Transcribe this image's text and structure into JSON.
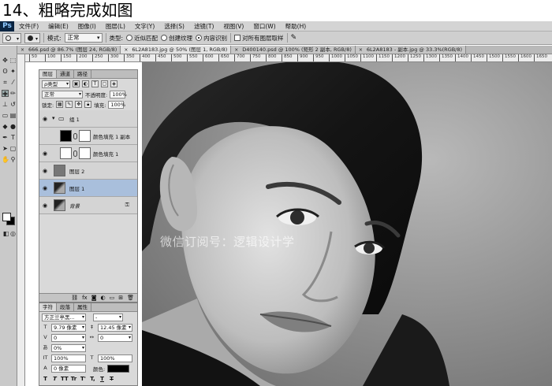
{
  "heading": "14、粗略完成如图",
  "app": {
    "logo": "Ps"
  },
  "menu": [
    "文件(F)",
    "编辑(E)",
    "图像(I)",
    "图层(L)",
    "文字(Y)",
    "选择(S)",
    "滤镜(T)",
    "视图(V)",
    "窗口(W)",
    "帮助(H)"
  ],
  "options": {
    "mode_label": "模式:",
    "mode_value": "正常",
    "type_label": "类型:",
    "type_options": [
      "近似匹配",
      "创建纹理",
      "内容识别"
    ],
    "type_selected_index": 2,
    "sample_all_label": "对所有图层取样"
  },
  "doc_tabs": [
    {
      "title": "666.psd @ 86.7% (图层 24, RGB/8)",
      "active": false
    },
    {
      "title": "6L2A8183.jpg @ 50% (图层 1, RGB/8)",
      "active": true
    },
    {
      "title": "D400140.psd @ 100% (矩形 2 副本, RGB/8)",
      "active": false
    },
    {
      "title": "6L2A8183 - 副本.jpg @ 33.3%(RGB/8)",
      "active": false
    }
  ],
  "ruler_ticks": [
    "50",
    "100",
    "150",
    "200",
    "250",
    "300",
    "350",
    "400",
    "450",
    "500",
    "550",
    "600",
    "650",
    "700",
    "750",
    "800",
    "850",
    "900",
    "950",
    "1000",
    "1050",
    "1100",
    "1150",
    "1200",
    "1250",
    "1300",
    "1350",
    "1400",
    "1450",
    "1500",
    "1550",
    "1600",
    "1650"
  ],
  "layers_panel": {
    "tabs": [
      "图层",
      "通道",
      "路径"
    ],
    "filter_label": "ρ类型",
    "blend_mode": "正常",
    "opacity_label": "不透明度:",
    "opacity_value": "100%",
    "lock_label": "锁定:",
    "fill_label": "填充:",
    "fill_value": "100%",
    "layers": [
      {
        "name": "组 1",
        "kind": "group",
        "visible": true,
        "selected": false
      },
      {
        "name": "颜色填充 1 副本",
        "kind": "fill",
        "visible": false,
        "selected": false
      },
      {
        "name": "颜色填充 1",
        "kind": "fill",
        "visible": true,
        "selected": false
      },
      {
        "name": "图层 2",
        "kind": "pixel-gray",
        "visible": true,
        "selected": false
      },
      {
        "name": "图层 1",
        "kind": "pixel-photo",
        "visible": true,
        "selected": true
      },
      {
        "name": "背景",
        "kind": "background",
        "visible": true,
        "selected": false,
        "locked": true
      }
    ]
  },
  "char_panel": {
    "tabs": [
      "字符",
      "段落",
      "属性"
    ],
    "font_family": "方正兰亭黑...",
    "font_style": "-",
    "font_size": "9.79 像素",
    "leading": "12.45 像素",
    "kerning": "0",
    "tracking": "0",
    "scale_pct": "0%",
    "vertical_scale": "100%",
    "horizontal_scale": "100%",
    "baseline": "0 像素",
    "color_label": "颜色:",
    "style_buttons": [
      "T",
      "T",
      "TT",
      "Tr",
      "T'",
      "T,",
      "T",
      "T"
    ]
  },
  "watermark": "微信订阅号：逻辑设计学"
}
